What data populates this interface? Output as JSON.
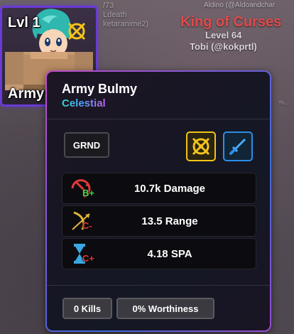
{
  "background": {
    "top_text": "Aldino (@Aldoandchar",
    "dim_1": "/73",
    "dim_2": "Ldeath",
    "dim_3": "ketaranime2)",
    "title": "King of Curses",
    "level": "Level 64",
    "player": "Tobi (@kokprtl)",
    "side_text": "Th..."
  },
  "unit_card": {
    "level_label": "Lvl 1",
    "name_label": "Army Bu",
    "trait_icon": "crossed-circle-icon"
  },
  "panel": {
    "unit_name": "Army Bulmy",
    "rarity": "Celestial",
    "placement": "GRND",
    "traits": [
      {
        "icon": "crossed-circle-icon",
        "color": "#f2c418"
      },
      {
        "icon": "sword-icon",
        "color": "#2d8ee8"
      }
    ],
    "stats": [
      {
        "icon": "damage-icon",
        "grade": "B+",
        "grade_color": "#4bd94b",
        "text": "10.7k Damage"
      },
      {
        "icon": "range-icon",
        "grade": "C-",
        "grade_color": "#e23a3a",
        "text": "13.5 Range"
      },
      {
        "icon": "spa-icon",
        "grade": "C+",
        "grade_color": "#e23a3a",
        "text": "4.18 SPA"
      }
    ],
    "kills": "0 Kills",
    "worthiness": "0% Worthiness"
  },
  "colors": {
    "celestial_gradient": [
      "#2fd7d0",
      "#4aa6ff",
      "#c45ce6"
    ],
    "card_border": "#6a3bd6"
  }
}
